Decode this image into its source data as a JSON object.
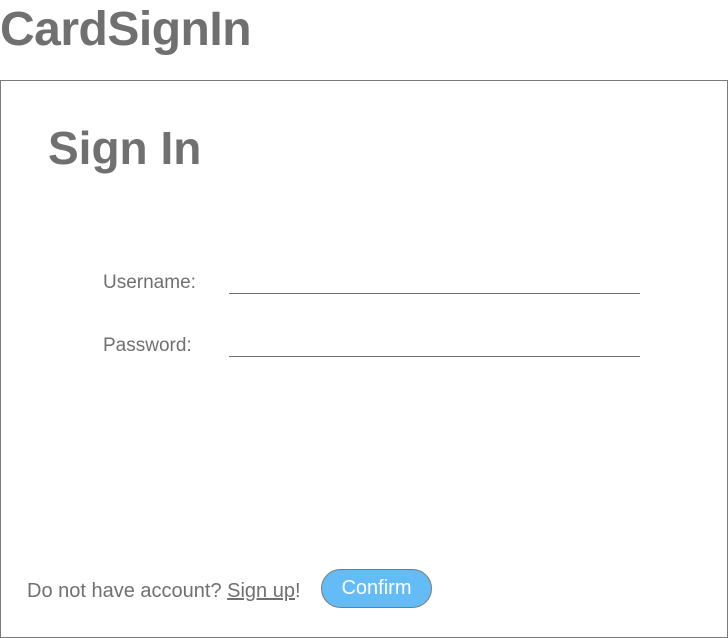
{
  "app": {
    "title": "CardSignIn"
  },
  "card": {
    "title": "Sign In"
  },
  "form": {
    "username": {
      "label": "Username:",
      "value": "",
      "placeholder": ""
    },
    "password": {
      "label": "Password:",
      "value": "",
      "placeholder": ""
    }
  },
  "footer": {
    "prompt": "Do not have account? ",
    "signup_label": "Sign up",
    "suffix": "!",
    "confirm_label": "Confirm"
  },
  "colors": {
    "text": "#707070",
    "border": "#7a7a7a",
    "confirm_button_bg": "#63bcf5",
    "confirm_button_text": "#ffffff"
  }
}
